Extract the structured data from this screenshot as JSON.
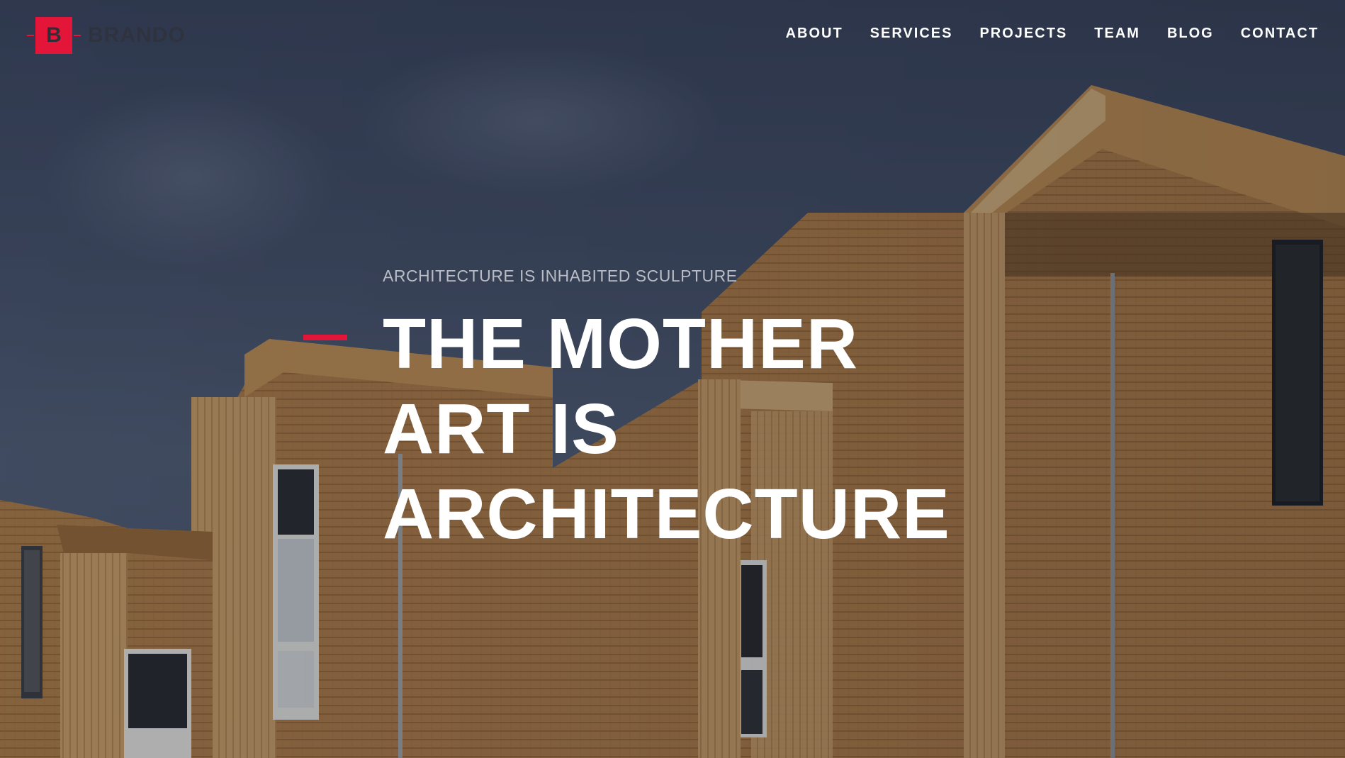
{
  "brand": {
    "logo_letter": "B",
    "name": "BRANDO",
    "accent_color": "#e3163a"
  },
  "nav": {
    "items": [
      "ABOUT",
      "SERVICES",
      "PROJECTS",
      "TEAM",
      "BLOG",
      "CONTACT"
    ]
  },
  "hero": {
    "tagline": "ARCHITECTURE IS INHABITED SCULPTURE",
    "headline_lines": [
      "THE MOTHER",
      "ART IS",
      "ARCHITECTURE"
    ],
    "background": "wooden-architecture-photo"
  }
}
